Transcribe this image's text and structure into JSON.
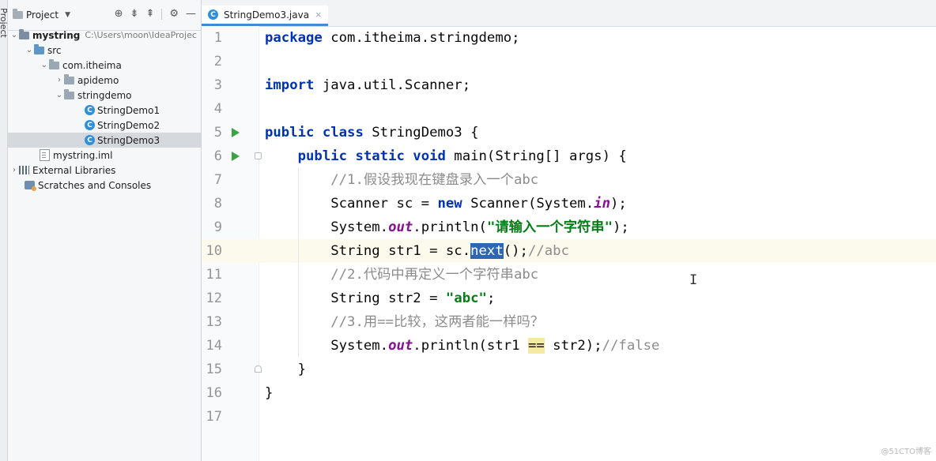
{
  "sidebar_stripe": {
    "label": "1: Project"
  },
  "project_panel": {
    "title": "Project",
    "tools": [
      "locate-icon",
      "expand-all-icon",
      "collapse-all-icon",
      "settings-gear-icon",
      "hide-icon"
    ],
    "tree": [
      {
        "label": "mystring",
        "path": "C:\\Users\\moon\\IdeaProjec",
        "icon": "module-folder-icon",
        "expanded": true,
        "depth": 0
      },
      {
        "label": "src",
        "icon": "source-folder-icon",
        "expanded": true,
        "depth": 1
      },
      {
        "label": "com.itheima",
        "icon": "package-icon",
        "expanded": true,
        "depth": 2
      },
      {
        "label": "apidemo",
        "icon": "package-icon",
        "expanded": false,
        "depth": 3
      },
      {
        "label": "stringdemo",
        "icon": "package-icon",
        "expanded": true,
        "depth": 3
      },
      {
        "label": "StringDemo1",
        "icon": "java-class-icon",
        "depth": 4
      },
      {
        "label": "StringDemo2",
        "icon": "java-class-icon",
        "depth": 4
      },
      {
        "label": "StringDemo3",
        "icon": "java-class-icon",
        "depth": 4,
        "selected": true
      },
      {
        "label": "mystring.iml",
        "icon": "iml-file-icon",
        "depth": 1
      },
      {
        "label": "External Libraries",
        "icon": "library-icon",
        "expanded": false,
        "depth": 0
      },
      {
        "label": "Scratches and Consoles",
        "icon": "scratch-icon",
        "depth": 0
      }
    ]
  },
  "editor": {
    "tab": {
      "label": "StringDemo3.java",
      "close": "×"
    },
    "current_line": 10,
    "lines": [
      {
        "n": "1"
      },
      {
        "n": "2"
      },
      {
        "n": "3"
      },
      {
        "n": "4"
      },
      {
        "n": "5"
      },
      {
        "n": "6"
      },
      {
        "n": "7"
      },
      {
        "n": "8"
      },
      {
        "n": "9"
      },
      {
        "n": "10"
      },
      {
        "n": "11"
      },
      {
        "n": "12"
      },
      {
        "n": "13"
      },
      {
        "n": "14"
      },
      {
        "n": "15"
      },
      {
        "n": "16"
      },
      {
        "n": "17"
      }
    ],
    "code": {
      "l1_kw": "package",
      "l1_rest": " com.itheima.stringdemo;",
      "l3_kw": "import",
      "l3_rest": " java.util.Scanner;",
      "l5_kw": "public class",
      "l5_rest": " StringDemo3 {",
      "l6_indent": "    ",
      "l6_kw": "public static void",
      "l6_rest": " main(String[] args) {",
      "l7_indent": "        ",
      "l7_cm": "//1.假设我现在键盘录入一个abc",
      "l8_indent": "        ",
      "l8_a": "Scanner sc = ",
      "l8_kw": "new",
      "l8_b": " Scanner(System.",
      "l8_it": "in",
      "l8_c": ");",
      "l9_indent": "        ",
      "l9_a": "System.",
      "l9_it": "out",
      "l9_b": ".println(",
      "l9_str": "\"请输入一个字符串\"",
      "l9_c": ");",
      "l10_indent": "        ",
      "l10_a": "String str1 = sc.",
      "l10_hl": "next",
      "l10_b": "();",
      "l10_cm": "//abc",
      "l11_indent": "        ",
      "l11_cm": "//2.代码中再定义一个字符串abc",
      "l12_indent": "        ",
      "l12_a": "String str2 = ",
      "l12_str": "\"abc\"",
      "l12_b": ";",
      "l13_indent": "        ",
      "l13_cm": "//3.用==比较，这两者能一样吗？",
      "l14_indent": "        ",
      "l14_a": "System.",
      "l14_it": "out",
      "l14_b": ".println(str1 ",
      "l14_eq": "==",
      "l14_c": " str2);",
      "l14_cm": "//false",
      "l15": "    }",
      "l16": "}"
    },
    "mouse_cursor": "I"
  },
  "watermark": "@51CTO博客"
}
